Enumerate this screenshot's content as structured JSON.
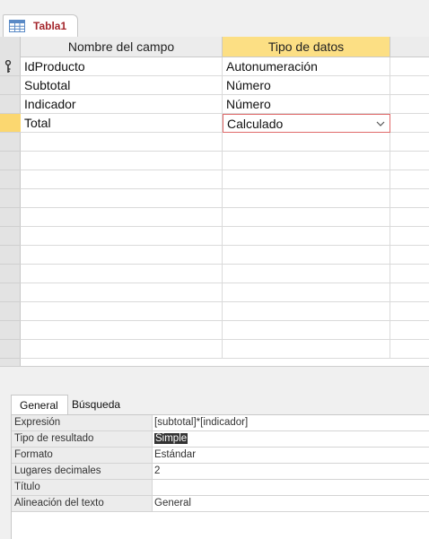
{
  "tab": {
    "title": "Tabla1",
    "icon": "table-icon"
  },
  "grid": {
    "headers": {
      "name": "Nombre del campo",
      "type": "Tipo de datos",
      "description": ""
    },
    "rows": [
      {
        "name": "IdProducto",
        "type": "Autonumeración",
        "is_key": true
      },
      {
        "name": "Subtotal",
        "type": "Número"
      },
      {
        "name": "Indicador",
        "type": "Número"
      },
      {
        "name": "Total",
        "type": "Calculado",
        "current": true
      }
    ]
  },
  "properties": {
    "tabs": [
      {
        "label": "General",
        "active": true
      },
      {
        "label": "Búsqueda",
        "active": false
      }
    ],
    "rows": [
      {
        "label": "Expresión",
        "value": "[subtotal]*[indicador]"
      },
      {
        "label": "Tipo de resultado",
        "value": "Simple",
        "selected": true
      },
      {
        "label": "Formato",
        "value": "Estándar"
      },
      {
        "label": "Lugares decimales",
        "value": "2"
      },
      {
        "label": "Título",
        "value": ""
      },
      {
        "label": "Alineación del texto",
        "value": "General"
      }
    ]
  },
  "colors": {
    "tab_title": "#a4262c",
    "header_selected": "#fcdf84",
    "row_current": "#fbd770",
    "edit_border": "#e06b6b"
  }
}
